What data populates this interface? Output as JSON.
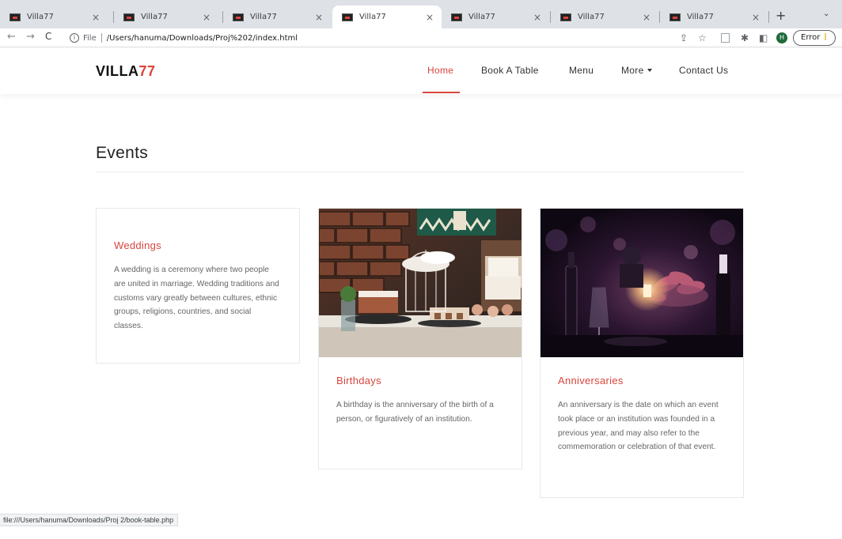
{
  "browser": {
    "tabs": [
      {
        "title": "Villa77",
        "active": false
      },
      {
        "title": "Villa77",
        "active": false
      },
      {
        "title": "Villa77",
        "active": false
      },
      {
        "title": "Villa77",
        "active": true
      },
      {
        "title": "Villa77",
        "active": false
      },
      {
        "title": "Villa77",
        "active": false
      },
      {
        "title": "Villa77",
        "active": false
      }
    ],
    "close_glyph": "×",
    "new_tab_glyph": "+",
    "tab_menu_glyph": "⌄",
    "back_glyph": "←",
    "forward_glyph": "→",
    "reload_glyph": "C",
    "info_glyph": "i",
    "scheme_label": "File",
    "url": "/Users/hanuma/Downloads/Proj%202/index.html",
    "share_glyph": "⇪",
    "bookmark_glyph": "☆",
    "extension_glyph": "✱",
    "sidepanel_glyph": "◧",
    "profile_initial": "H",
    "error_label": "Error",
    "error_dots": "⋮"
  },
  "site": {
    "logo_main": "VILLA",
    "logo_accent": "77",
    "nav": [
      {
        "label": "Home",
        "active": true
      },
      {
        "label": "Book A Table",
        "active": false
      },
      {
        "label": "Menu",
        "active": false
      },
      {
        "label": "More",
        "active": false,
        "dropdown": true
      },
      {
        "label": "Contact Us",
        "active": false
      }
    ]
  },
  "events": {
    "title": "Events",
    "cards": [
      {
        "title": "Weddings",
        "text": "A wedding is a ceremony where two people are united in marriage. Wedding traditions and customs vary greatly between cultures, ethnic groups, religions, countries, and social classes.",
        "has_image": false
      },
      {
        "title": "Birthdays",
        "text": "A birthday is the anniversary of the birth of a person, or figuratively of an institution.",
        "has_image": true,
        "image": "dessert-table-photo"
      },
      {
        "title": "Anniversaries",
        "text": "An anniversary is the date on which an event took place or an institution was founded in a previous year, and may also refer to the commemoration or celebration of that event.",
        "has_image": true,
        "image": "candlelit-dinner-photo"
      }
    ]
  },
  "status_bar": {
    "link": "file:///Users/hanuma/Downloads/Proj 2/book-table.php"
  },
  "colors": {
    "accent": "#d9453c",
    "text": "#333333",
    "muted_text": "#666666",
    "chrome_bg": "#dee1e6"
  }
}
